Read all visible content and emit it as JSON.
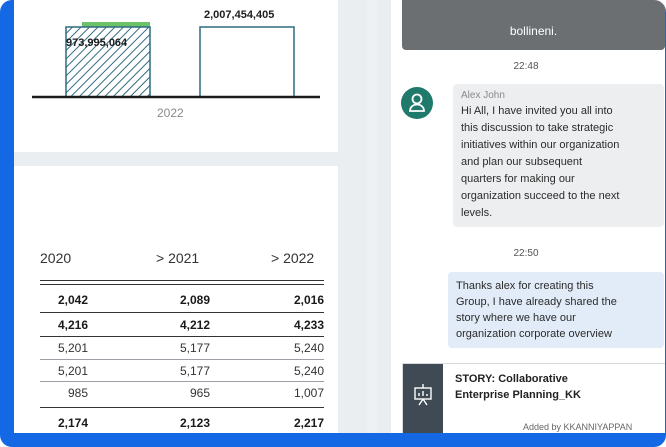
{
  "chart_data": {
    "type": "bar",
    "categories": [
      "2022"
    ],
    "series": [
      {
        "values": [
          973995064
        ]
      },
      {
        "values": [
          2007454405
        ]
      }
    ],
    "bar_labels": [
      "973,995,064",
      "2,007,454,405"
    ]
  },
  "chart": {
    "x_tick": "2022",
    "colors": {
      "bar_outline": "#2f6b80",
      "top_strip": "#6cc268"
    }
  },
  "table": {
    "headers": [
      "2020",
      "> 2021",
      "> 2022"
    ],
    "rows": [
      {
        "cells": [
          "2,042",
          "2,089",
          "2,016"
        ],
        "bold": true
      },
      {
        "cells": [
          "4,216",
          "4,212",
          "4,233"
        ],
        "bold": true
      },
      {
        "cells": [
          "5,201",
          "5,177",
          "5,240"
        ],
        "bold": false
      },
      {
        "cells": [
          "5,201",
          "5,177",
          "5,240"
        ],
        "bold": false
      },
      {
        "cells": [
          "985",
          "965",
          "1,007"
        ],
        "bold": false
      },
      {
        "cells": [
          "2,174",
          "2,123",
          "2,217"
        ],
        "bold": true
      }
    ]
  },
  "chat": {
    "top_bubble_text": "bollineni.",
    "time1": "22:48",
    "msg1": {
      "author": "Alex John",
      "lines": [
        "Hi All, I have invited you all into",
        "this discussion to take strategic",
        "initiatives within our organization",
        "and plan our subsequent",
        "quarters for making our",
        "organization succeed to the next",
        "levels."
      ]
    },
    "time2": "22:50",
    "msg2": {
      "lines": [
        "Thanks alex for creating this",
        "Group, I have already shared the",
        "story where we have our",
        "organization corporate overview"
      ]
    },
    "story_card": {
      "title_line1": "STORY: Collaborative",
      "title_line2": "Enterprise Planning_KK",
      "added_by": "Added by KKANNIYAPPAN"
    }
  }
}
